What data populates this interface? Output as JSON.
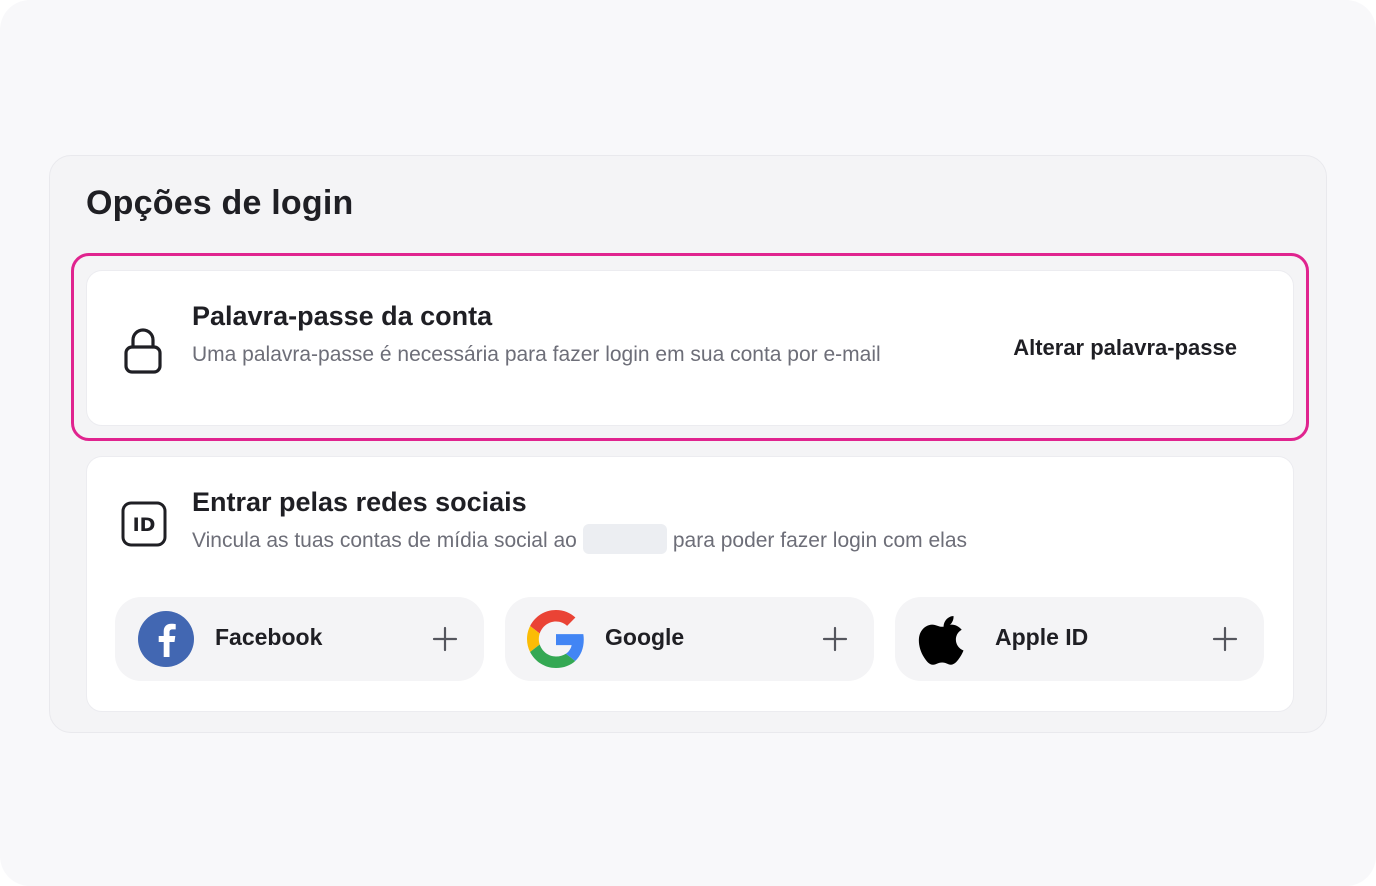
{
  "panel": {
    "title": "Opções de login"
  },
  "password_card": {
    "heading": "Palavra-passe da conta",
    "description": "Uma palavra-passe é necessária para fazer login em sua conta por e-mail",
    "action_label": "Alterar palavra-passe",
    "icon": "lock-icon",
    "highlight_color": "#e0248f"
  },
  "social_card": {
    "heading": "Entrar pelas redes sociais",
    "description_before": "Vincula as tuas contas de mídia social ao",
    "description_after": "para poder fazer login com elas",
    "icon": "id-card-icon",
    "providers": [
      {
        "label": "Facebook",
        "icon": "facebook-icon",
        "color": "#4267b2"
      },
      {
        "label": "Google",
        "icon": "google-icon",
        "color": "#4285f4"
      },
      {
        "label": "Apple ID",
        "icon": "apple-icon",
        "color": "#000000"
      }
    ]
  }
}
